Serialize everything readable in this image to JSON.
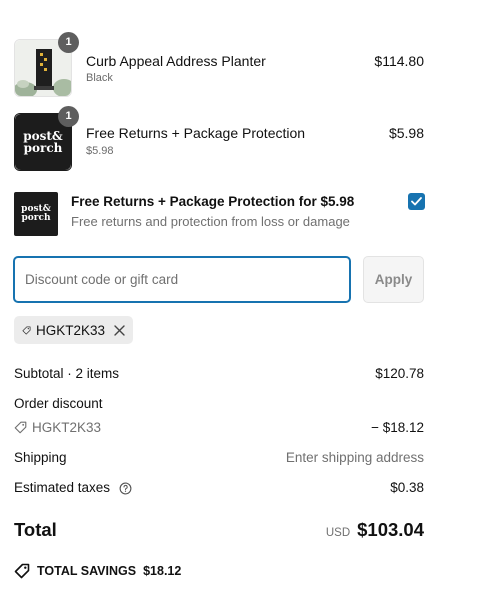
{
  "line_items": [
    {
      "name": "Curb Appeal Address Planter",
      "variant": "Black",
      "price": "$114.80",
      "quantity": "1"
    },
    {
      "name": "Free Returns + Package Protection",
      "variant": "$5.98",
      "price": "$5.98",
      "quantity": "1",
      "logo_line1": "post&",
      "logo_line2": "porch"
    }
  ],
  "protection": {
    "title": "Free Returns + Package Protection for $5.98",
    "description": "Free returns and protection from loss or damage",
    "checked": true,
    "logo_line1": "post&",
    "logo_line2": "porch"
  },
  "discount": {
    "placeholder": "Discount code or gift card",
    "value": "",
    "apply_label": "Apply",
    "applied_code": "HGKT2K33"
  },
  "summary": {
    "subtotal_label": "Subtotal · 2 items",
    "subtotal_value": "$120.78",
    "order_discount_label": "Order discount",
    "discount_code": "HGKT2K33",
    "discount_value": "− $18.12",
    "shipping_label": "Shipping",
    "shipping_value": "Enter shipping address",
    "taxes_label": "Estimated taxes",
    "taxes_value": "$0.38",
    "total_label": "Total",
    "currency": "USD",
    "total_value": "$103.04",
    "savings_label": "TOTAL SAVINGS",
    "savings_value": "$18.12"
  },
  "colors": {
    "accent": "#1773b0",
    "muted_text": "#707070",
    "badge": "#5e5e5e"
  }
}
